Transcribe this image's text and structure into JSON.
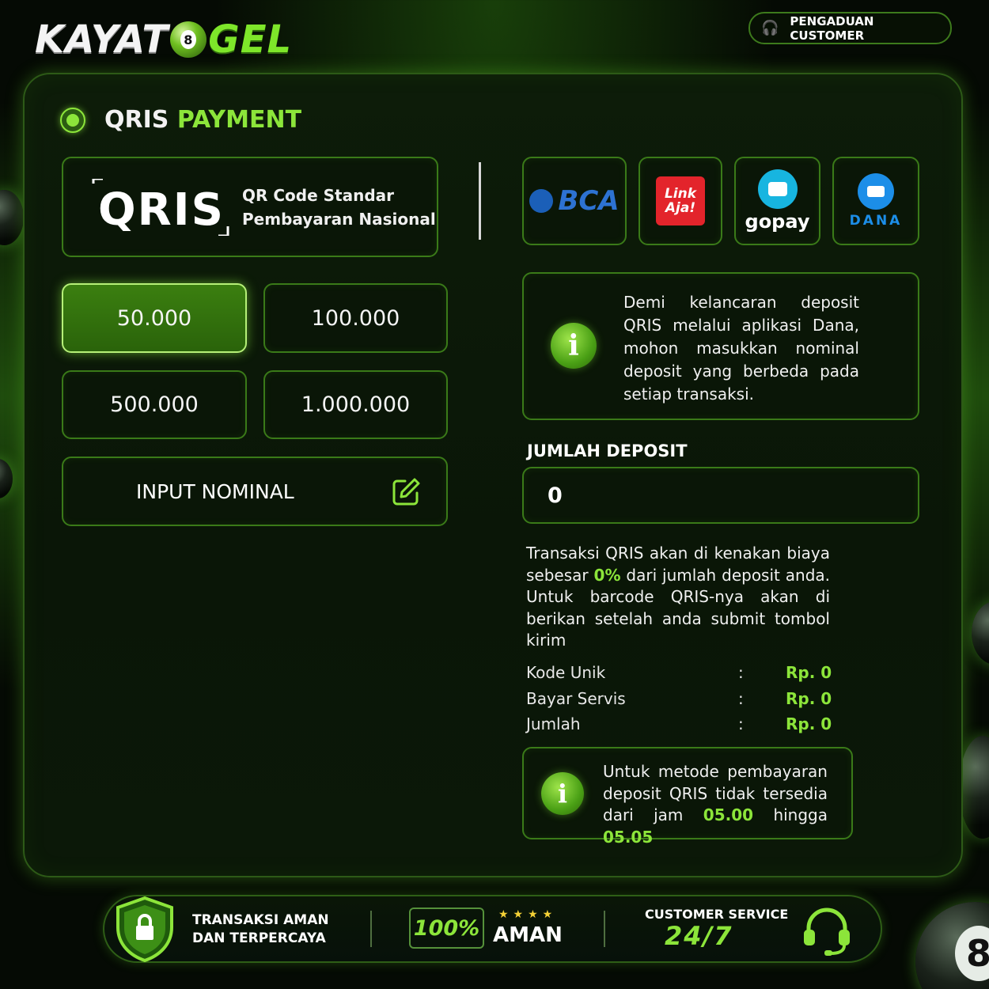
{
  "brand": {
    "logo_left": "KAYAT",
    "logo_ball": "8",
    "logo_right": "GEL"
  },
  "header": {
    "complaint_label": "PENGADUAN CUSTOMER"
  },
  "page": {
    "title_white": "QRIS",
    "title_green": "PAYMENT"
  },
  "qris": {
    "logo_text": "QRIS",
    "line1": "QR Code Standar",
    "line2": "Pembayaran Nasional"
  },
  "providers": {
    "bca": "BCA",
    "linkaja_1": "Link",
    "linkaja_2": "Aja!",
    "gopay": "gopay",
    "dana": "DANA"
  },
  "amounts": [
    {
      "label": "50.000",
      "selected": true
    },
    {
      "label": "100.000",
      "selected": false
    },
    {
      "label": "500.000",
      "selected": false
    },
    {
      "label": "1.000.000",
      "selected": false
    }
  ],
  "input_nominal": {
    "label": "INPUT NOMINAL"
  },
  "notice_top": "Demi kelancaran deposit QRIS melalui aplikasi Dana, mohon masukkan nominal deposit yang berbeda pada setiap transaksi.",
  "deposit": {
    "label": "JUMLAH DEPOSIT",
    "value": "0"
  },
  "fee_text": {
    "part1": "Transaksi QRIS akan di kenakan biaya sebesar ",
    "pct": "0%",
    "part2": " dari jumlah deposit anda. Untuk barcode QRIS-nya akan di berikan setelah anda submit tombol kirim"
  },
  "summary": [
    {
      "label": "Kode Unik",
      "colon": ":",
      "value": "Rp. 0"
    },
    {
      "label": "Bayar Servis",
      "colon": ":",
      "value": "Rp. 0"
    },
    {
      "label": "Jumlah",
      "colon": ":",
      "value": "Rp. 0"
    }
  ],
  "notice_bottom": {
    "part1": "Untuk metode pembayaran deposit QRIS tidak tersedia dari jam ",
    "t1": "05.00",
    "mid": " hingga ",
    "t2": "05.05"
  },
  "footer": {
    "trust_1": "TRANSAKSI AMAN",
    "trust_2": "DAN TERPERCAYA",
    "percent": "100%",
    "stars": "★★★★",
    "aman": "AMAN",
    "cs_label": "CUSTOMER SERVICE",
    "cs_hours": "24/7"
  },
  "colors": {
    "accent": "#8ce53a",
    "panel": "#0a1607",
    "border": "#3a7a18",
    "star": "#f5d236"
  },
  "icons": [
    "headset-icon",
    "info-icon",
    "edit-icon",
    "shield-lock-icon",
    "eight-ball-icon"
  ]
}
